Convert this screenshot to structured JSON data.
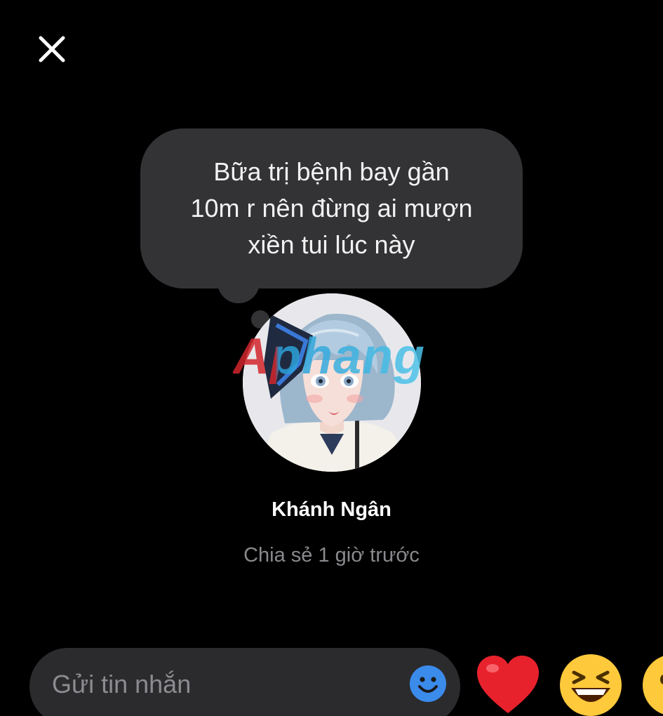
{
  "note": {
    "text": "Bữa trị bệnh bay gần\n10m r nên đừng ai mượn\nxiền tui lúc này"
  },
  "watermark": "Aphang",
  "profile": {
    "name": "Khánh Ngân",
    "shared_time": "Chia sẻ 1 giờ trước"
  },
  "composer": {
    "placeholder": "Gửi tin nhắn"
  },
  "icons": {
    "close": "close-icon",
    "emoji": "smiley-icon",
    "reactions": [
      "heart-emoji",
      "grinning-squinting-emoji",
      "surprised-emoji"
    ]
  },
  "colors": {
    "background": "#000000",
    "bubble": "#333336",
    "composer": "#2b2b2e",
    "emoji_button": "#3b8beb",
    "muted_text": "#8a8a8e"
  }
}
